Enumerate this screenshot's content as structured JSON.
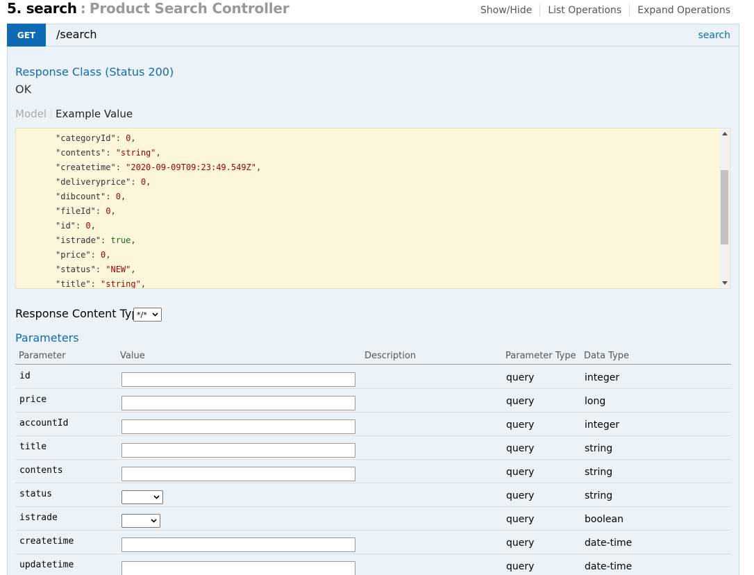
{
  "heading": {
    "number_name": "5. search",
    "separator": ":",
    "description": "Product Search Controller"
  },
  "header_links": [
    "Show/Hide",
    "List Operations",
    "Expand Operations"
  ],
  "operation": {
    "method": "GET",
    "path": "/search",
    "tag_link": "search"
  },
  "response_class": {
    "title": "Response Class (Status 200)",
    "status_text": "OK"
  },
  "model_tabs": {
    "model": "Model",
    "example": "Example Value"
  },
  "example_lines": [
    {
      "key": "\"categoryId\"",
      "value": "0",
      "kind": "n"
    },
    {
      "key": "\"contents\"",
      "value": "\"string\"",
      "kind": "s"
    },
    {
      "key": "\"createtime\"",
      "value": "\"2020-09-09T09:23:49.549Z\"",
      "kind": "s"
    },
    {
      "key": "\"deliveryprice\"",
      "value": "0",
      "kind": "n"
    },
    {
      "key": "\"dibcount\"",
      "value": "0",
      "kind": "n"
    },
    {
      "key": "\"fileId\"",
      "value": "0",
      "kind": "n"
    },
    {
      "key": "\"id\"",
      "value": "0",
      "kind": "n"
    },
    {
      "key": "\"istrade\"",
      "value": "true",
      "kind": "b"
    },
    {
      "key": "\"price\"",
      "value": "0",
      "kind": "n"
    },
    {
      "key": "\"status\"",
      "value": "\"NEW\"",
      "kind": "s"
    },
    {
      "key": "\"title\"",
      "value": "\"string\"",
      "kind": "s"
    }
  ],
  "response_content_type": {
    "label": "Response Content Type",
    "selected": "*/*"
  },
  "parameters": {
    "title": "Parameters",
    "columns": [
      "Parameter",
      "Value",
      "Description",
      "Parameter Type",
      "Data Type"
    ],
    "rows": [
      {
        "name": "id",
        "control": "input",
        "param_type": "query",
        "data_type": "integer"
      },
      {
        "name": "price",
        "control": "input",
        "param_type": "query",
        "data_type": "long"
      },
      {
        "name": "accountId",
        "control": "input",
        "param_type": "query",
        "data_type": "integer"
      },
      {
        "name": "title",
        "control": "input",
        "param_type": "query",
        "data_type": "string"
      },
      {
        "name": "contents",
        "control": "input",
        "param_type": "query",
        "data_type": "string"
      },
      {
        "name": "status",
        "control": "select",
        "param_type": "query",
        "data_type": "string"
      },
      {
        "name": "istrade",
        "control": "select",
        "param_type": "query",
        "data_type": "boolean"
      },
      {
        "name": "createtime",
        "control": "input",
        "param_type": "query",
        "data_type": "date-time"
      },
      {
        "name": "updatetime",
        "control": "input",
        "param_type": "query",
        "data_type": "date-time"
      }
    ]
  },
  "colors": {
    "accent": "#0f6ab4",
    "op_background": "#ebf3f9",
    "code_background": "#fcf6db"
  }
}
